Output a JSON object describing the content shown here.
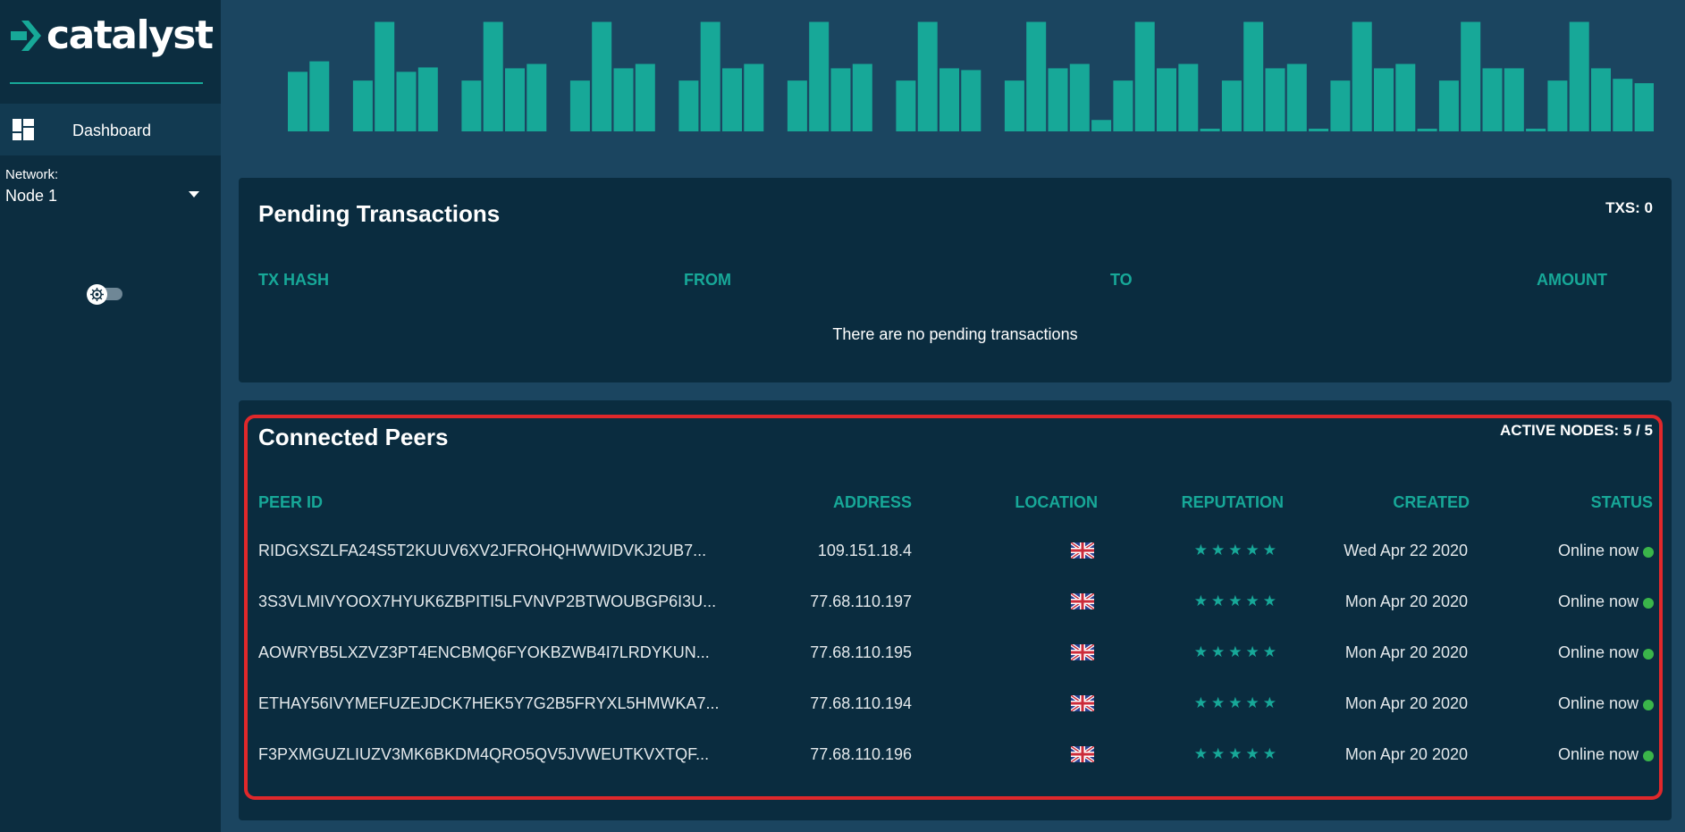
{
  "sidebar": {
    "logo_text": "catalyst",
    "nav": [
      {
        "label": "Dashboard",
        "icon": "dashboard-icon"
      }
    ],
    "network": {
      "label": "Network:",
      "value": "Node 1"
    },
    "theme_toggle_icon": "settings-icon"
  },
  "colors": {
    "background": "#1b4560",
    "sidebar": "#0c2d40",
    "panel": "#0a2c3f",
    "accent": "#17a898",
    "status_online": "#3ab54a",
    "highlight": "#e0282b"
  },
  "bar_chart": {
    "type": "bar",
    "color": "#17a898",
    "values": [
      68,
      80,
      0,
      58,
      125,
      68,
      73,
      0,
      58,
      125,
      72,
      77,
      0,
      58,
      125,
      72,
      77,
      0,
      58,
      125,
      72,
      77,
      0,
      58,
      125,
      72,
      77,
      0,
      58,
      125,
      72,
      70,
      0,
      58,
      125,
      72,
      77,
      13,
      58,
      125,
      72,
      77,
      2,
      58,
      125,
      72,
      77,
      2,
      58,
      125,
      72,
      77,
      2,
      58,
      125,
      72,
      72,
      2,
      58,
      125,
      72,
      60,
      55
    ]
  },
  "pending": {
    "title": "Pending Transactions",
    "count": "TXS: 0",
    "columns": [
      "TX HASH",
      "FROM",
      "TO",
      "AMOUNT"
    ],
    "empty_message": "There are no pending transactions"
  },
  "peers": {
    "title": "Connected Peers",
    "count": "ACTIVE NODES: 5 / 5",
    "columns": [
      "PEER ID",
      "ADDRESS",
      "LOCATION",
      "REPUTATION",
      "CREATED",
      "STATUS"
    ],
    "rows": [
      {
        "id": "RIDGXSZLFA24S5T2KUUV6XV2JFROHQHWWIDVKJ2UB7...",
        "address": "109.151.18.4",
        "location": "uk-flag-icon",
        "reputation": "★★★★★",
        "created": "Wed Apr 22 2020",
        "status": "Online now"
      },
      {
        "id": "3S3VLMIVYOOX7HYUK6ZBPITI5LFVNVP2BTWOUBGP6I3U...",
        "address": "77.68.110.197",
        "location": "uk-flag-icon",
        "reputation": "★★★★★",
        "created": "Mon Apr 20 2020",
        "status": "Online now"
      },
      {
        "id": "AOWRYB5LXZVZ3PT4ENCBMQ6FYOKBZWB4I7LRDYKUN...",
        "address": "77.68.110.195",
        "location": "uk-flag-icon",
        "reputation": "★★★★★",
        "created": "Mon Apr 20 2020",
        "status": "Online now"
      },
      {
        "id": "ETHAY56IVYMEFUZEJDCK7HEK5Y7G2B5FRYXL5HMWKA7...",
        "address": "77.68.110.194",
        "location": "uk-flag-icon",
        "reputation": "★★★★★",
        "created": "Mon Apr 20 2020",
        "status": "Online now"
      },
      {
        "id": "F3PXMGUZLIUZV3MK6BKDM4QRO5QV5JVWEUTKVXTQF...",
        "address": "77.68.110.196",
        "location": "uk-flag-icon",
        "reputation": "★★★★★",
        "created": "Mon Apr 20 2020",
        "status": "Online now"
      }
    ]
  }
}
